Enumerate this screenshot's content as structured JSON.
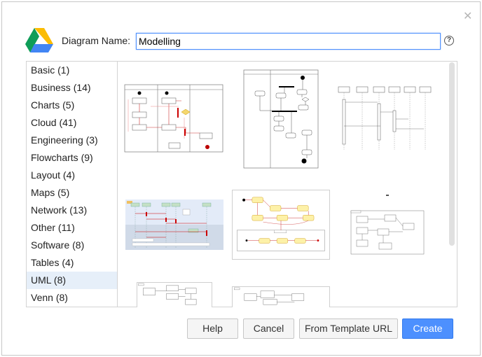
{
  "dialog": {
    "name_label": "Diagram Name:",
    "name_value": "Modelling"
  },
  "categories": [
    {
      "label": "Basic (1)"
    },
    {
      "label": "Business (14)"
    },
    {
      "label": "Charts (5)"
    },
    {
      "label": "Cloud (41)"
    },
    {
      "label": "Engineering (3)"
    },
    {
      "label": "Flowcharts (9)"
    },
    {
      "label": "Layout (4)"
    },
    {
      "label": "Maps (5)"
    },
    {
      "label": "Network (13)"
    },
    {
      "label": "Other (11)"
    },
    {
      "label": "Software (8)"
    },
    {
      "label": "Tables (4)"
    },
    {
      "label": "UML (8)",
      "selected": true
    },
    {
      "label": "Venn (8)"
    }
  ],
  "buttons": {
    "help": "Help",
    "cancel": "Cancel",
    "template_url": "From Template URL",
    "create": "Create"
  },
  "colors": {
    "primary": "#4d90fe",
    "selection": "#e6eff9"
  }
}
